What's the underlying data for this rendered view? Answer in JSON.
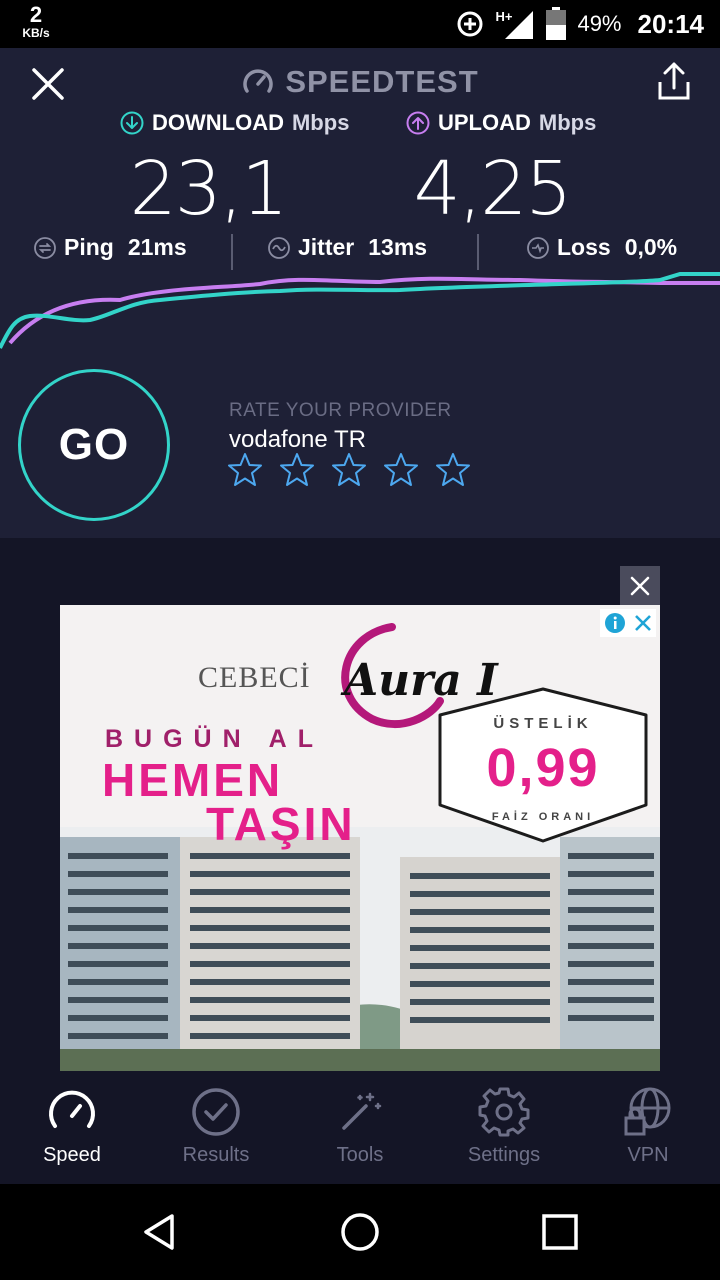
{
  "status_bar": {
    "net_speed_value": "2",
    "net_speed_unit": "KB/s",
    "network_type": "H+",
    "battery_percent": "49%",
    "time": "20:14"
  },
  "header": {
    "title": "SPEEDTEST"
  },
  "results": {
    "download": {
      "label": "DOWNLOAD",
      "unit": "Mbps",
      "value": "23,1",
      "color": "#33d4c9"
    },
    "upload": {
      "label": "UPLOAD",
      "unit": "Mbps",
      "value": "4,25",
      "color": "#c77ef0"
    },
    "ping": {
      "label": "Ping",
      "value": "21ms"
    },
    "jitter": {
      "label": "Jitter",
      "value": "13ms"
    },
    "loss": {
      "label": "Loss",
      "value": "0,0%"
    }
  },
  "go_button": {
    "label": "GO",
    "ring_color": "#33d4c9"
  },
  "rating": {
    "label": "RATE YOUR PROVIDER",
    "provider": "vodafone TR",
    "stars_total": 5,
    "stars_selected": 0
  },
  "ad": {
    "brand": "CEBECİ",
    "logo_text": "Aura I",
    "line1": "BUGÜN AL",
    "line2": "HEMEN",
    "line3": "TAŞIN",
    "badge_top": "ÜSTELİK",
    "badge_value": "0,99",
    "badge_bottom": "FAİZ ORANI"
  },
  "bottom_nav": {
    "items": [
      {
        "label": "Speed",
        "icon": "speedometer-icon",
        "active": true
      },
      {
        "label": "Results",
        "icon": "checkmark-circle-icon",
        "active": false
      },
      {
        "label": "Tools",
        "icon": "magic-wand-icon",
        "active": false
      },
      {
        "label": "Settings",
        "icon": "gear-icon",
        "active": false
      },
      {
        "label": "VPN",
        "icon": "globe-lock-icon",
        "active": false
      }
    ]
  },
  "colors": {
    "background": "#141526",
    "panel": "#1e2036",
    "accent_teal": "#33d4c9",
    "accent_purple": "#c77ef0"
  }
}
